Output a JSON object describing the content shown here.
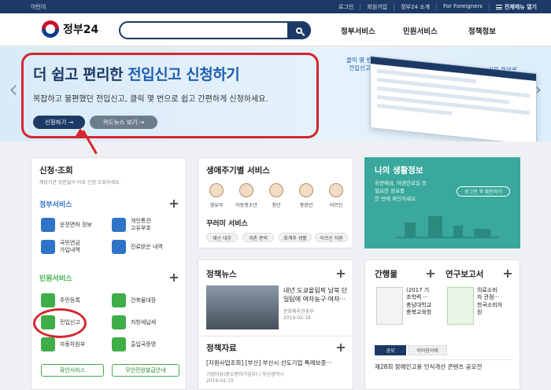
{
  "topbar": {
    "lang": "어린이",
    "links": [
      "로그인",
      "회원가입",
      "정부24 소개",
      "For Foreigners"
    ],
    "menu_open": "전체메뉴 열기"
  },
  "header": {
    "logo": "정부24",
    "search_placeholder": "",
    "nav": [
      "정부서비스",
      "민원서비스",
      "정책정보"
    ]
  },
  "banner": {
    "title_part1": "더 쉽고 편리한 ",
    "title_part2": "전입신고 신청하기",
    "subtitle": "복잡하고 불편했던 전입신고, 클릭 몇 번으로 쉽고 간편하게 신청하세요.",
    "btn_apply": "신청하기 →",
    "btn_cardnews": "카드뉴스 보기 →",
    "bubble1": "클릭 몇 번이면\n전입신고 끝!",
    "bubble2": "쉬운 용어로\n알기 쉽게~"
  },
  "apply": {
    "title": "신청·조회",
    "desc": "해당기관 방문없이 바로 신청·조회하세요.",
    "gov_title": "정부서비스",
    "gov_items": [
      "운전면허 정보",
      "개인통관\n고유부호",
      "국민연금\n가입내역",
      "진료받은 내역"
    ],
    "civil_title": "민원서비스",
    "civil_items": [
      "주민등록",
      "건축물대장",
      "전입신고",
      "지방세납세",
      "자동차원부",
      "출입국증명"
    ],
    "btn_confirm": "확인서비스",
    "btn_free": "무인민원발급안내"
  },
  "life": {
    "title": "생애주기별 서비스",
    "stages": [
      "영유아",
      "아동청소년",
      "청년",
      "중장년",
      "어르신"
    ],
    "keywords_title": "꾸러미 서비스",
    "keywords": [
      "재난 대응",
      "귀촌 준비",
      "회계후 생활",
      "어르신 지원"
    ]
  },
  "mylife": {
    "title": "나의 생활정보",
    "desc": "휴면예금, 여권만료일 등\n필요한 정보를\n한 번에 확인하세요.",
    "btn": "로그인 후 확인하기",
    "bg": "#3aa89c"
  },
  "policy_news": {
    "title": "정책뉴스",
    "headline": "내년 도쿄올림픽 남북 단\n일팀에 여자농구·여자···",
    "source": "문화체육관광부",
    "date": "2019-02-18"
  },
  "policy_data": {
    "title": "정책자료",
    "headline": "[지원사업조회] [부산] 부산시 선도기업 특례보증···",
    "source": "기업마당(중소벤처기업부) / 부산광역시",
    "date": "2019-02-15"
  },
  "publication": {
    "title": "간행물",
    "excerpt": "(2017 기\n초학력 ···\n충남대학교\n충북교육청"
  },
  "research": {
    "title": "연구보고서",
    "excerpt": "의료소비\n자 관점···\n한국소비자\n원"
  },
  "contest": {
    "tab_active": "공모",
    "tab_inactive": "여러참여제",
    "text": "제28회 장애인고용 인식개선 콘텐츠 공모전"
  },
  "colors": {
    "navy": "#1d3a66",
    "red_highlight": "#d6262e",
    "green": "#3fae49",
    "teal": "#3aa89c"
  }
}
